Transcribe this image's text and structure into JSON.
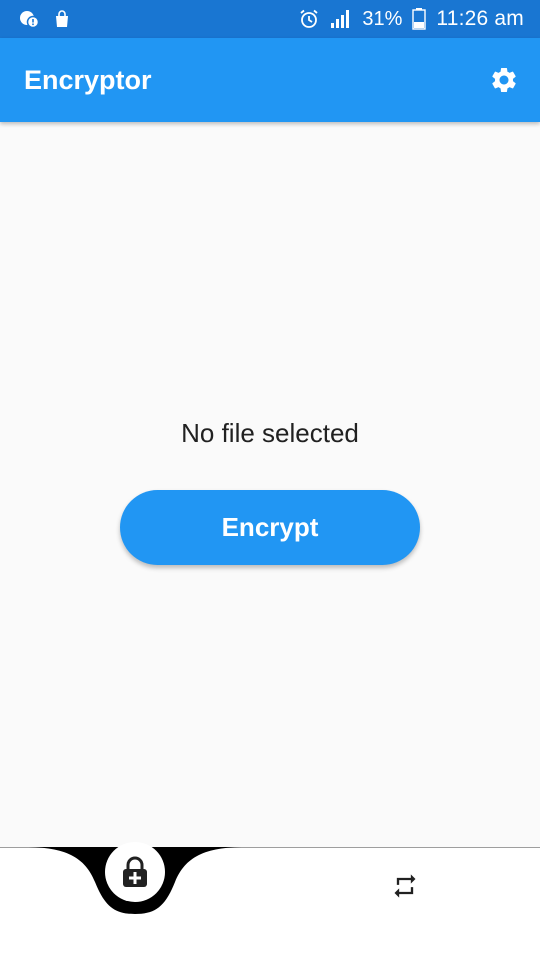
{
  "status_bar": {
    "time": "11:26 am",
    "battery_percent": "31%",
    "icons": [
      "whatsapp-notification-icon",
      "shopping-bag-icon",
      "alarm-icon",
      "signal-icon",
      "battery-icon"
    ]
  },
  "app_bar": {
    "title": "Encryptor",
    "settings_icon": "gear-icon"
  },
  "main": {
    "status_text": "No file selected",
    "encrypt_label": "Encrypt"
  },
  "bottom_nav": {
    "items": [
      {
        "icon": "lock-add-icon",
        "active": true
      },
      {
        "icon": "repeat-icon",
        "active": false
      }
    ]
  },
  "colors": {
    "status_bar": "#1976d2",
    "app_bar": "#2196f3",
    "accent": "#2196f3",
    "background": "#fafafa",
    "nav_notch": "#000000"
  }
}
